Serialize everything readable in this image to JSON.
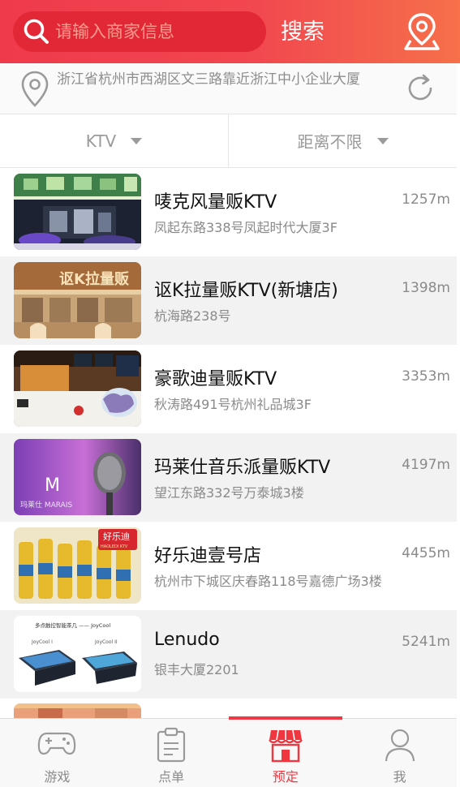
{
  "header": {
    "search_placeholder": "请输入商家信息",
    "search_label": "搜索",
    "search_icon": "search-icon",
    "location_icon": "location-pin-icon"
  },
  "address": {
    "text": "浙江省杭州市西湖区文三路靠近浙江中小企业大厦",
    "pin_icon": "map-pin-icon",
    "refresh_icon": "refresh-icon"
  },
  "filters": [
    {
      "label": "KTV"
    },
    {
      "label": "距离不限"
    }
  ],
  "merchants": [
    {
      "name": "唛克风量贩KTV",
      "address": "凤起东路338号凤起时代大厦3F",
      "distance": "1257m"
    },
    {
      "name": "讴K拉量贩KTV(新塘店)",
      "address": "杭海路238号",
      "distance": "1398m"
    },
    {
      "name": "豪歌迪量贩KTV",
      "address": "秋涛路491号杭州礼品城3F",
      "distance": "3353m"
    },
    {
      "name": "玛莱仕音乐派量贩KTV",
      "address": "望江东路332号万泰城3楼",
      "distance": "4197m"
    },
    {
      "name": "好乐迪壹号店",
      "address": "杭州市下城区庆春路118号嘉德广场3楼",
      "distance": "4455m"
    },
    {
      "name": "Lenudo",
      "address": "银丰大厦2201",
      "distance": "5241m"
    }
  ],
  "thumb_text": {
    "t2_sign": "讴K拉量贩",
    "t4_logo": "M",
    "t4_brand": "玛莱仕 MARAIS",
    "t5_brand": "好乐迪",
    "t5_sub": "HAOLEDI KTV",
    "t6_title": "多点触控智能茶几 —— JoyCool",
    "t6_left": "JoyCool I",
    "t6_right": "JoyCool II"
  },
  "tabs": [
    {
      "label": "游戏",
      "icon": "gamepad-icon"
    },
    {
      "label": "点单",
      "icon": "clipboard-icon"
    },
    {
      "label": "预定",
      "icon": "storefront-icon",
      "active": true
    },
    {
      "label": "我",
      "icon": "user-icon"
    }
  ],
  "colors": {
    "accent": "#ef3a45",
    "header_start": "#ef3a4c",
    "header_end": "#f6704a",
    "search_bg": "#e22836",
    "muted_text": "#8a8a8a"
  }
}
